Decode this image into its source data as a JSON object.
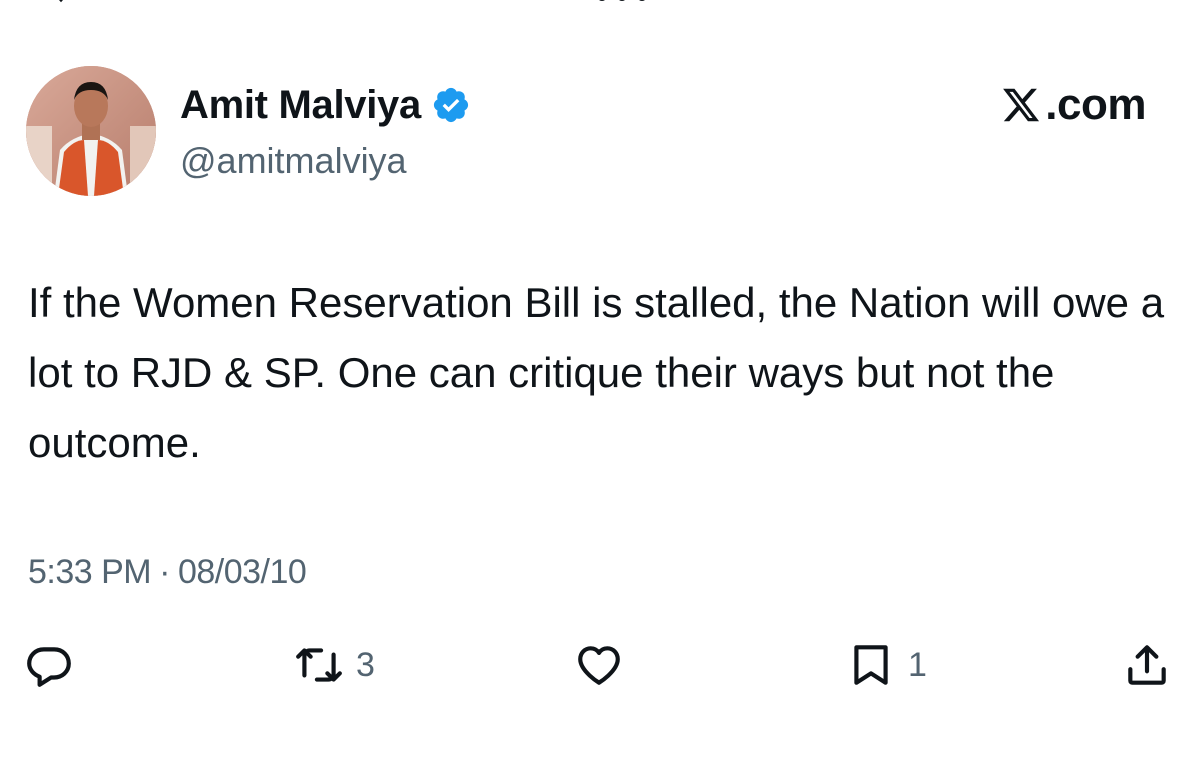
{
  "tweet": {
    "author": {
      "display_name": "Amit Malviya",
      "handle": "@amitmalviya",
      "verified": true
    },
    "brand": {
      "logo_icon": "x-logo-icon",
      "suffix": ".com"
    },
    "text": "If the Women Reservation Bill is stalled, the Nation will owe a lot to RJD & SP. One can critique their ways but not the outcome.",
    "time": "5:33 PM",
    "separator": "·",
    "date": "08/03/10",
    "actions": {
      "reply": {
        "icon": "reply-icon",
        "count": ""
      },
      "retweet": {
        "icon": "retweet-icon",
        "count": "3"
      },
      "like": {
        "icon": "heart-icon",
        "count": ""
      },
      "bookmark": {
        "icon": "bookmark-icon",
        "count": "1"
      },
      "share": {
        "icon": "share-icon"
      }
    }
  },
  "colors": {
    "text_primary": "#0f1419",
    "text_secondary": "#536471",
    "verified_blue": "#1d9bf0"
  }
}
